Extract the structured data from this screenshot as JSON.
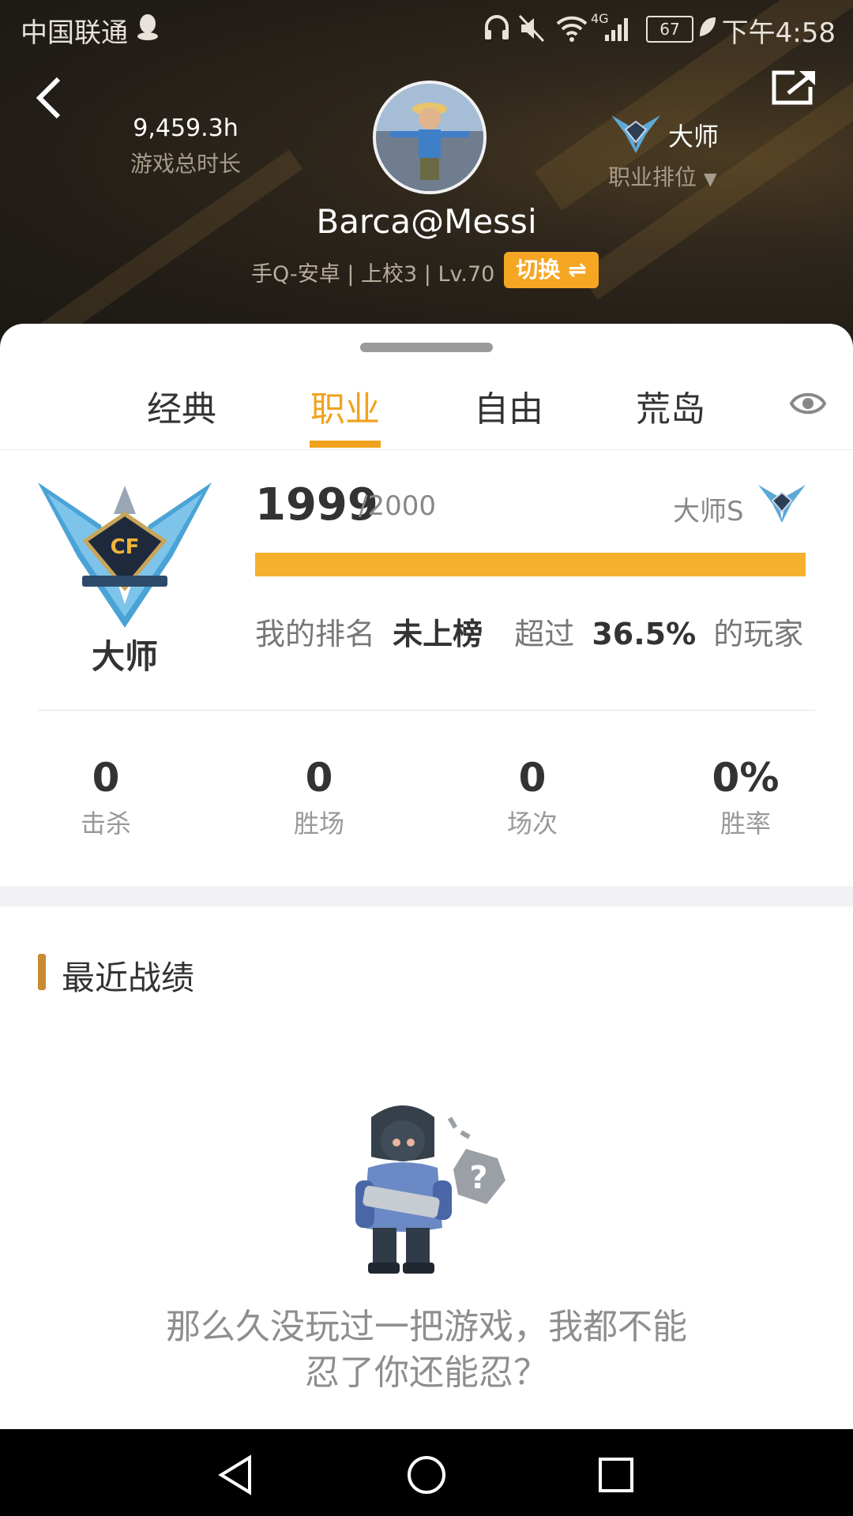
{
  "status_bar": {
    "carrier": "中国联通",
    "network": "4G",
    "battery": "67",
    "time": "下午4:58"
  },
  "header": {
    "playtime_value": "9,459.3h",
    "playtime_label": "游戏总时长",
    "rank_name": "大师",
    "rank_dropdown_label": "职业排位",
    "username": "Barca@Messi",
    "player_info": "手Q-安卓 | 上校3 | Lv.70",
    "switch_label": "切换 ⇌"
  },
  "tabs": [
    {
      "label": "经典",
      "active": false
    },
    {
      "label": "职业",
      "active": true
    },
    {
      "label": "自由",
      "active": false
    },
    {
      "label": "荒岛",
      "active": false
    }
  ],
  "rank_card": {
    "emblem_label": "大师",
    "score": "1999",
    "score_max": "/2000",
    "tier_label": "大师S",
    "progress_fraction": 0.9995,
    "rank_prefix": "我的排名",
    "rank_value": "未上榜",
    "exceed_prefix": "超过",
    "exceed_value": "36.5%",
    "exceed_suffix": "的玩家"
  },
  "stats": [
    {
      "value": "0",
      "label": "击杀"
    },
    {
      "value": "0",
      "label": "胜场"
    },
    {
      "value": "0",
      "label": "场次"
    },
    {
      "value": "0%",
      "label": "胜率"
    }
  ],
  "recent": {
    "title": "最近战绩",
    "empty_line1": "那么久没玩过一把游戏，我都不能",
    "empty_line2": "忍了你还能忍？"
  },
  "colors": {
    "accent": "#f0a31f",
    "progress": "#f5b12e",
    "section_bar": "#c98a33"
  },
  "icons": {
    "back": "chevron-left-icon",
    "share": "share-icon",
    "eye": "eye-icon",
    "nav_back": "triangle-back-icon",
    "nav_home": "circle-home-icon",
    "nav_recents": "square-recents-icon"
  }
}
